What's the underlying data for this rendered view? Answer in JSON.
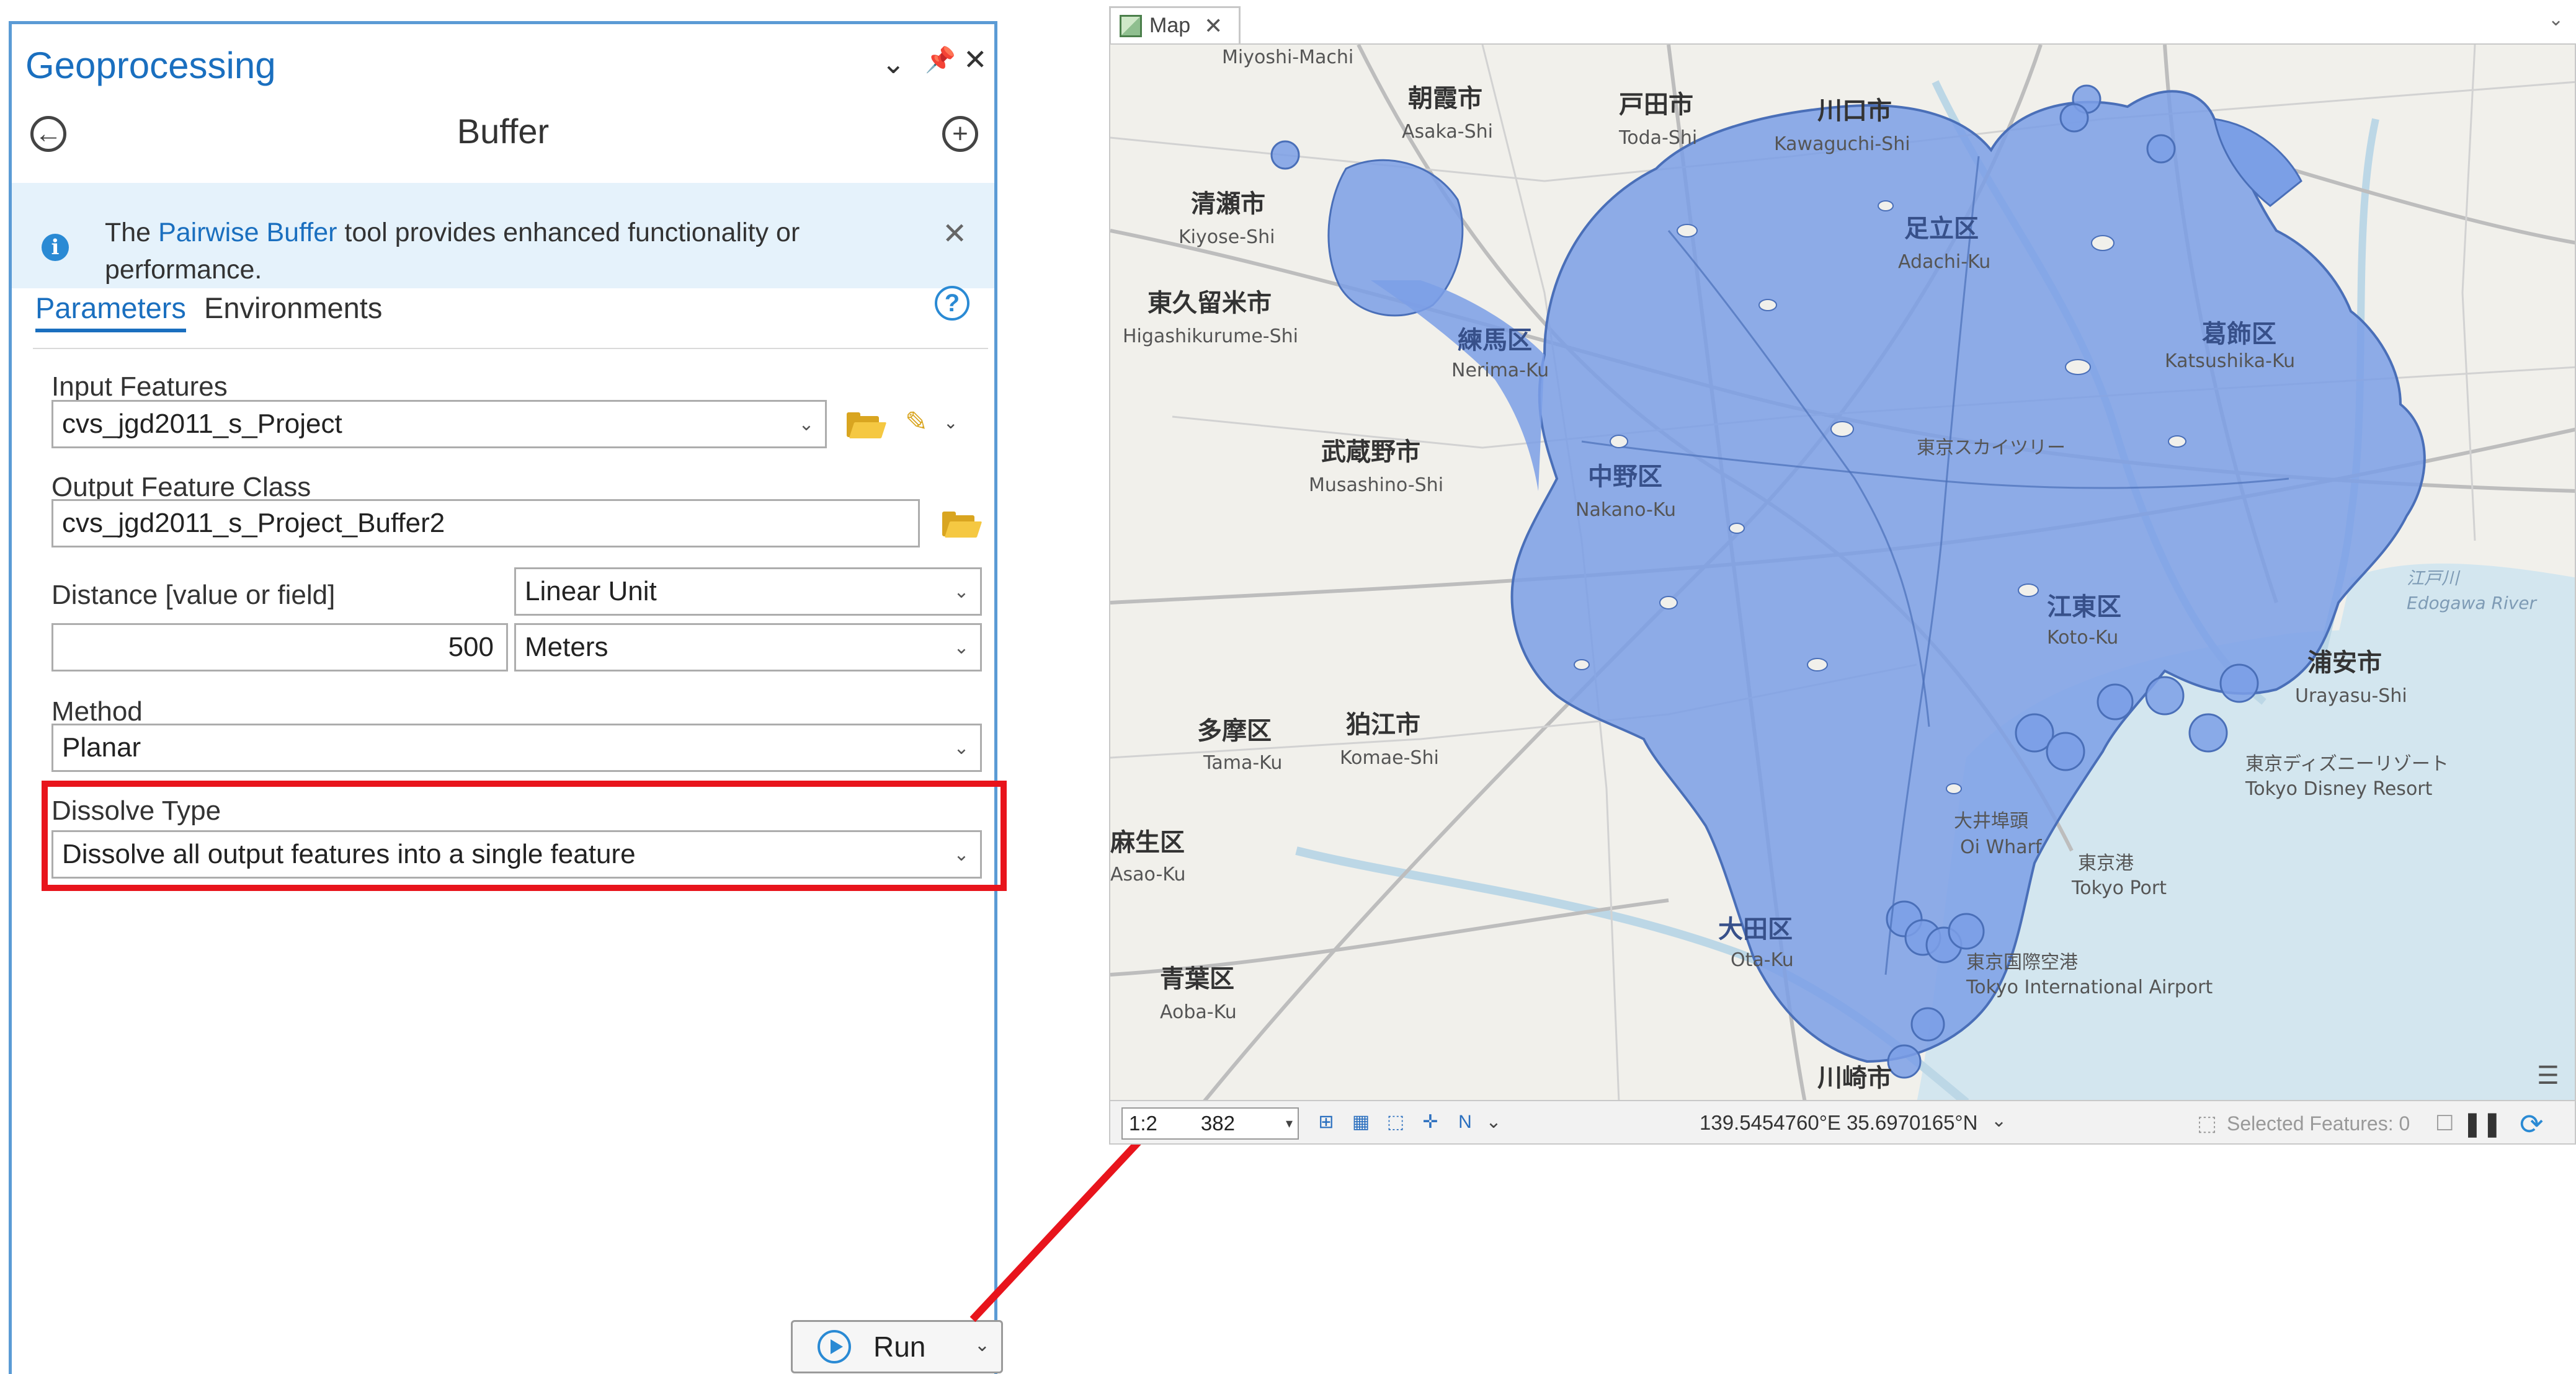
{
  "geoprocessing": {
    "pane_title": "Geoprocessing",
    "tool_title": "Buffer",
    "banner": {
      "text_before": "The",
      "link_text": "Pairwise Buffer",
      "text_after": "tool provides enhanced functionality or performance."
    },
    "tabs": [
      {
        "label": "Parameters",
        "active": true
      },
      {
        "label": "Environments",
        "active": false
      }
    ],
    "input_features": {
      "label": "Input Features",
      "value": "cvs_jgd2011_s_Project"
    },
    "output_feature_class": {
      "label": "Output Feature Class",
      "value": "cvs_jgd2011_s_Project_Buffer2"
    },
    "distance": {
      "label": "Distance [value or field]",
      "mode": "Linear Unit",
      "value": "500",
      "unit": "Meters"
    },
    "method": {
      "label": "Method",
      "value": "Planar"
    },
    "dissolve_type": {
      "label": "Dissolve Type",
      "value": "Dissolve all output features into a single feature"
    },
    "run_label": "Run"
  },
  "map": {
    "tab_label": "Map",
    "scale": "1:2",
    "scale_suffix": "382",
    "coordinates": "139.5454760°E 35.6970165°N",
    "selected_features": "Selected Features: 0",
    "labels": {
      "miyoshi": "Miyoshi-Machi",
      "asaka_jp": "朝霞市",
      "asaka": "Asaka-Shi",
      "toda_jp": "戸田市",
      "toda": "Toda-Shi",
      "kawaguchi_jp": "川口市",
      "kawaguchi": "Kawaguchi-Shi",
      "kiyose_jp": "清瀬市",
      "kiyose": "Kiyose-Shi",
      "higashikurume_jp": "東久留米市",
      "higashikurume": "Higashikurume-Shi",
      "nerima_jp": "練馬区",
      "nerima": "Nerima-Ku",
      "musashino_jp": "武蔵野市",
      "musashino": "Musashino-Shi",
      "nakano_jp": "中野区",
      "nakano": "Nakano-Ku",
      "adachi_jp": "足立区",
      "adachi": "Adachi-Ku",
      "katsushika_jp": "葛飾区",
      "katsushika": "Katsushika-Ku",
      "koto_jp": "江東区",
      "koto": "Koto-Ku",
      "ota_jp": "大田区",
      "ota": "Ota-Ku",
      "urayasu_jp": "浦安市",
      "urayasu": "Urayasu-Shi",
      "tamaku_jp": "多摩区",
      "tamaku": "Tama-Ku",
      "komae_jp": "狛江市",
      "komae": "Komae-Shi",
      "asao_jp": "麻生区",
      "asao": "Asao-Ku",
      "aoba_jp": "青葉区",
      "aoba": "Aoba-Ku",
      "kawasaki_jp": "川崎市",
      "disney_jp": "東京ディズニーリゾート",
      "disney": "Tokyo Disney Resort",
      "tokyoport_jp": "東京港",
      "tokyoport": "Tokyo Port",
      "haneda_jp": "東京国際空港",
      "haneda": "Tokyo International Airport",
      "oiwharf_jp": "大井埠頭",
      "oiwharf": "Oi Wharf",
      "edogawa_jp": "江戸川",
      "edogawa": "Edogawa River",
      "skytree": "東京スカイツリー"
    }
  },
  "colors": {
    "accent": "#1a6fbf",
    "highlight": "#e8141c",
    "buffer_fill": "#7b9fe6",
    "buffer_stroke": "#4a6fb8",
    "water": "#d3e6ef",
    "land": "#f1f0eb"
  }
}
